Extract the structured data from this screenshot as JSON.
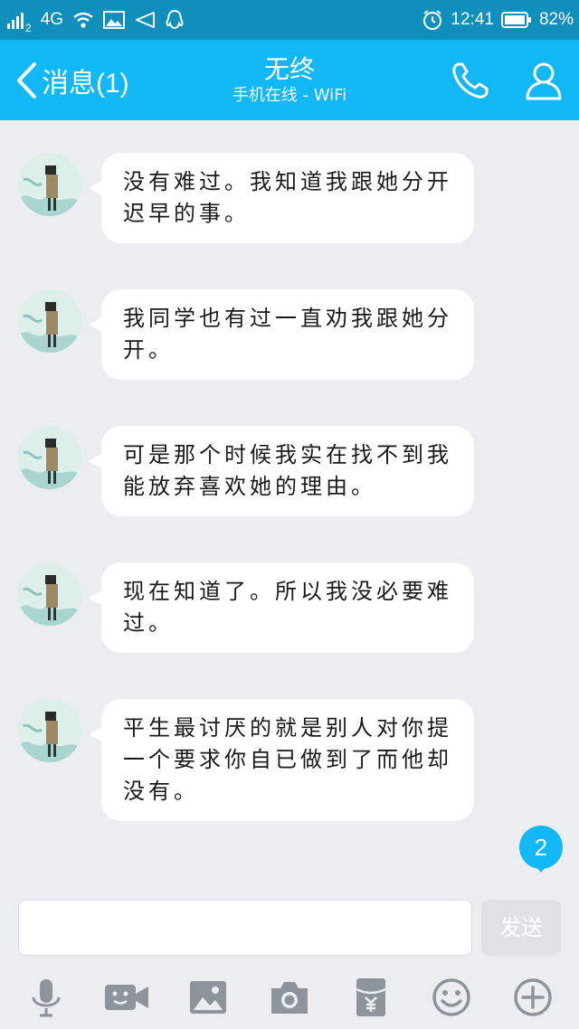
{
  "status_bar": {
    "sim": "2",
    "network": "4G",
    "time": "12:41",
    "battery": "82%",
    "background": "#0e8fbc"
  },
  "header": {
    "back_label": "消息(1)",
    "title": "无终",
    "subtitle": "手机在线 - WiFi",
    "background": "#12b7f5",
    "icons": [
      "phone-icon",
      "profile-icon"
    ]
  },
  "messages": [
    {
      "text": "没有难过。我知道我跟她分开迟早的事。"
    },
    {
      "text": "我同学也有过一直劝我跟她分开。"
    },
    {
      "text": "可是那个时候我实在找不到我能放弃喜欢她的理由。"
    },
    {
      "text": "现在知道了。所以我没必要难过。"
    },
    {
      "text": "平生最讨厌的就是别人对你提一个要求你自已做到了而他却没有。"
    }
  ],
  "new_message_badge": "2",
  "input": {
    "placeholder": "",
    "send_label": "发送"
  },
  "toolbar": [
    "microphone-icon",
    "video-icon",
    "image-icon",
    "camera-icon",
    "red-packet-icon",
    "emoji-icon",
    "plus-icon"
  ],
  "colors": {
    "accent": "#12b7f5",
    "chat_background": "#ebedf1",
    "icon_gray": "#8e949c"
  }
}
